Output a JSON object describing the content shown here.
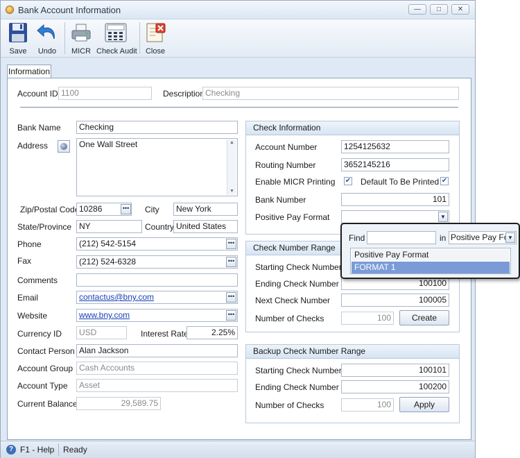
{
  "window": {
    "title": "Bank Account Information",
    "minimize_glyph": "—",
    "maximize_glyph": "□",
    "close_glyph": "✕"
  },
  "toolbar": {
    "save": "Save",
    "undo": "Undo",
    "micr": "MICR",
    "check_audit": "Check Audit",
    "close": "Close"
  },
  "tabs": {
    "information": "Information"
  },
  "form": {
    "account_id_label": "Account ID",
    "account_id": "1100",
    "description_label": "Description",
    "description": "Checking",
    "bank_name_label": "Bank Name",
    "bank_name": "Checking",
    "address_label": "Address",
    "address": "One Wall Street",
    "zip_label": "Zip/Postal Code",
    "zip": "10286",
    "city_label": "City",
    "city": "New York",
    "state_label": "State/Province",
    "state": "NY",
    "country_label": "Country",
    "country": "United States",
    "phone_label": "Phone",
    "phone": "(212) 542-5154",
    "fax_label": "Fax",
    "fax": "(212) 524-6328",
    "comments_label": "Comments",
    "comments": "",
    "email_label": "Email",
    "email": "contactus@bny.com",
    "website_label": "Website",
    "website": "www.bny.com",
    "currency_label": "Currency ID",
    "currency": "USD",
    "interest_label": "Interest Rate",
    "interest": "2.25%",
    "contact_label": "Contact Person",
    "contact": "Alan Jackson",
    "group_label": "Account Group",
    "group": "Cash Accounts",
    "type_label": "Account Type",
    "type": "Asset",
    "balance_label": "Current Balance",
    "balance": "29,589.75"
  },
  "check_info": {
    "title": "Check Information",
    "account_number_label": "Account Number",
    "account_number": "1254125632",
    "routing_label": "Routing Number",
    "routing": "3652145216",
    "micr_label": "Enable MICR Printing",
    "micr_checked": true,
    "default_label": "Default To Be Printed",
    "default_checked": true,
    "bank_number_label": "Bank Number",
    "bank_number": "101",
    "pos_pay_label": "Positive Pay Format",
    "pos_pay": ""
  },
  "check_range": {
    "title": "Check Number Range",
    "start_label": "Starting Check Number",
    "start": "",
    "end_label": "Ending Check Number",
    "end": "100100",
    "next_label": "Next Check Number",
    "next": "100005",
    "count_label": "Number of Checks",
    "count": "100",
    "create": "Create"
  },
  "backup_range": {
    "title": "Backup Check Number Range",
    "start_label": "Starting Check Number",
    "start": "100101",
    "end_label": "Ending Check Number",
    "end": "100200",
    "count_label": "Number of Checks",
    "count": "100",
    "apply": "Apply"
  },
  "popup": {
    "find_label": "Find",
    "find_value": "",
    "in_label": "in",
    "in_value": "Positive Pay Forr",
    "header": "Positive Pay Format",
    "rows": [
      "FORMAT 1"
    ]
  },
  "status": {
    "help": "F1 - Help",
    "state": "Ready"
  },
  "colors": {
    "accent": "#3d6fb8",
    "selection": "#7b9bd8"
  }
}
